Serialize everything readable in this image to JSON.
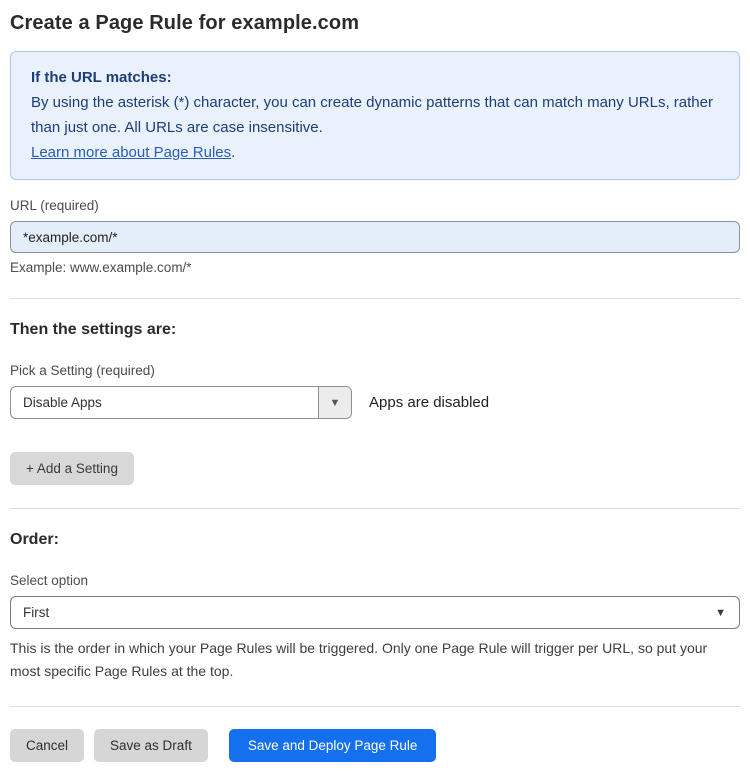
{
  "page": {
    "title": "Create a Page Rule for example.com"
  },
  "info_box": {
    "heading": "If the URL matches:",
    "body": "By using the asterisk (*) character, you can create dynamic patterns that can match many URLs, rather than just one. All URLs are case insensitive.",
    "link_label": "Learn more about Page Rules",
    "link_suffix": "."
  },
  "url_field": {
    "label": "URL (required)",
    "value": "*example.com/*",
    "helper": "Example: www.example.com/*"
  },
  "settings_section": {
    "heading": "Then the settings are:",
    "setting_label": "Pick a Setting (required)",
    "setting_value": "Disable Apps",
    "setting_status": "Apps are disabled",
    "add_button_label": "+ Add a Setting"
  },
  "order_section": {
    "heading": "Order:",
    "label": "Select option",
    "value": "First",
    "helper": "This is the order in which your Page Rules will be triggered. Only one Page Rule will trigger per URL, so put your most specific Page Rules at the top."
  },
  "footer": {
    "cancel_label": "Cancel",
    "save_draft_label": "Save as Draft",
    "save_deploy_label": "Save and Deploy Page Rule"
  },
  "icons": {
    "dropdown_arrow": "▼"
  },
  "colors": {
    "accent_blue": "#1570EF",
    "info_box_bg": "#e8f1fc",
    "info_box_border": "#a9c9ee",
    "info_text": "#1e3d77",
    "link_blue": "#2b5db8",
    "url_input_bg": "#e4eefb",
    "gray_button_bg": "#d6d6d6"
  }
}
